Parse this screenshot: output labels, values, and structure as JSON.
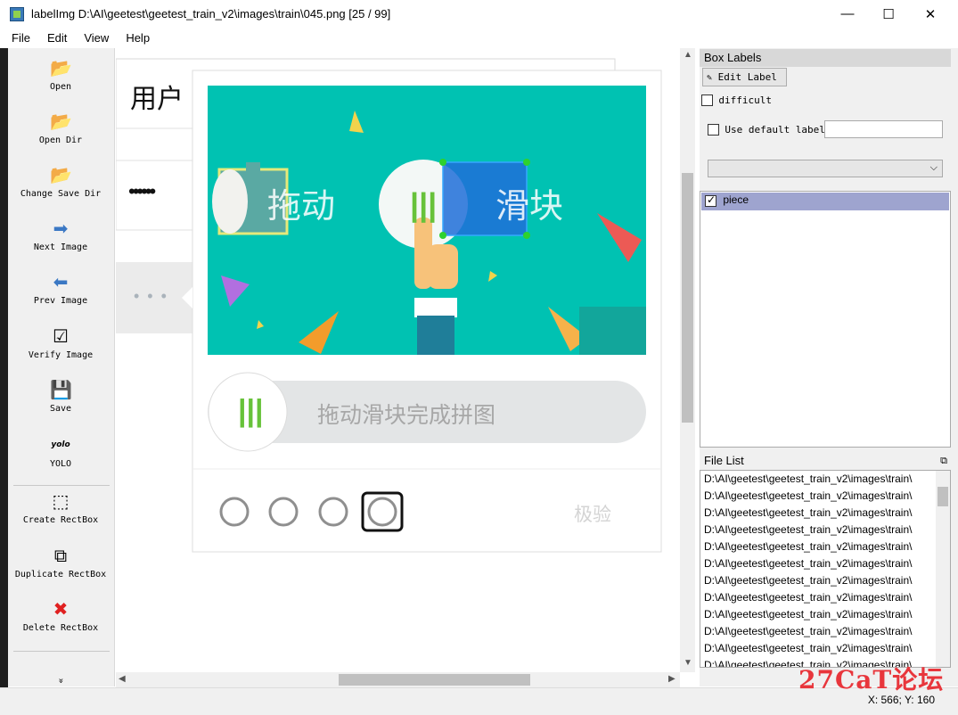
{
  "window": {
    "title": "labelImg D:\\AI\\geetest\\geetest_train_v2\\images\\train\\045.png [25 / 99]",
    "minimize": "—",
    "maximize": "☐",
    "close": "✕"
  },
  "menu": {
    "file": "File",
    "edit": "Edit",
    "view": "View",
    "help": "Help"
  },
  "toolbar": {
    "open": "Open",
    "open_dir": "Open Dir",
    "change_save_dir": "Change Save Dir",
    "next_image": "Next Image",
    "prev_image": "Prev Image",
    "verify_image": "Verify Image",
    "save": "Save",
    "yolo_icon_text": "yolo",
    "yolo": "YOLO",
    "create_rectbox": "Create RectBox",
    "duplicate_rectbox": "Duplicate RectBox",
    "delete_rectbox": "Delete RectBox",
    "more": "»"
  },
  "image": {
    "username_label": "用户",
    "password_mask": "••••••",
    "captcha_text_left": "拖动",
    "captcha_text_right": "滑块",
    "slider_hint": "拖动滑块完成拼图",
    "brand": "极验",
    "slider_bars": "|||",
    "dots": "• • •",
    "annotation_color": "#1e6fd8",
    "handle_color": "#2ed12e",
    "captcha_bg": "#00c2b2"
  },
  "box_labels": {
    "title": "Box Labels",
    "edit_label": "Edit Label",
    "difficult": "difficult",
    "use_default_label": "Use default label",
    "default_label_value": "",
    "dropdown_value": "",
    "labels": [
      {
        "name": "piece",
        "checked": true
      }
    ]
  },
  "file_list": {
    "title": "File List",
    "items": [
      "D:\\AI\\geetest\\geetest_train_v2\\images\\train\\",
      "D:\\AI\\geetest\\geetest_train_v2\\images\\train\\",
      "D:\\AI\\geetest\\geetest_train_v2\\images\\train\\",
      "D:\\AI\\geetest\\geetest_train_v2\\images\\train\\",
      "D:\\AI\\geetest\\geetest_train_v2\\images\\train\\",
      "D:\\AI\\geetest\\geetest_train_v2\\images\\train\\",
      "D:\\AI\\geetest\\geetest_train_v2\\images\\train\\",
      "D:\\AI\\geetest\\geetest_train_v2\\images\\train\\",
      "D:\\AI\\geetest\\geetest_train_v2\\images\\train\\",
      "D:\\AI\\geetest\\geetest_train_v2\\images\\train\\",
      "D:\\AI\\geetest\\geetest_train_v2\\images\\train\\",
      "D:\\AI\\geetest\\geetest_train_v2\\images\\train\\"
    ]
  },
  "status": {
    "coords": "X: 566; Y: 160"
  },
  "watermark": "27CaT论坛"
}
